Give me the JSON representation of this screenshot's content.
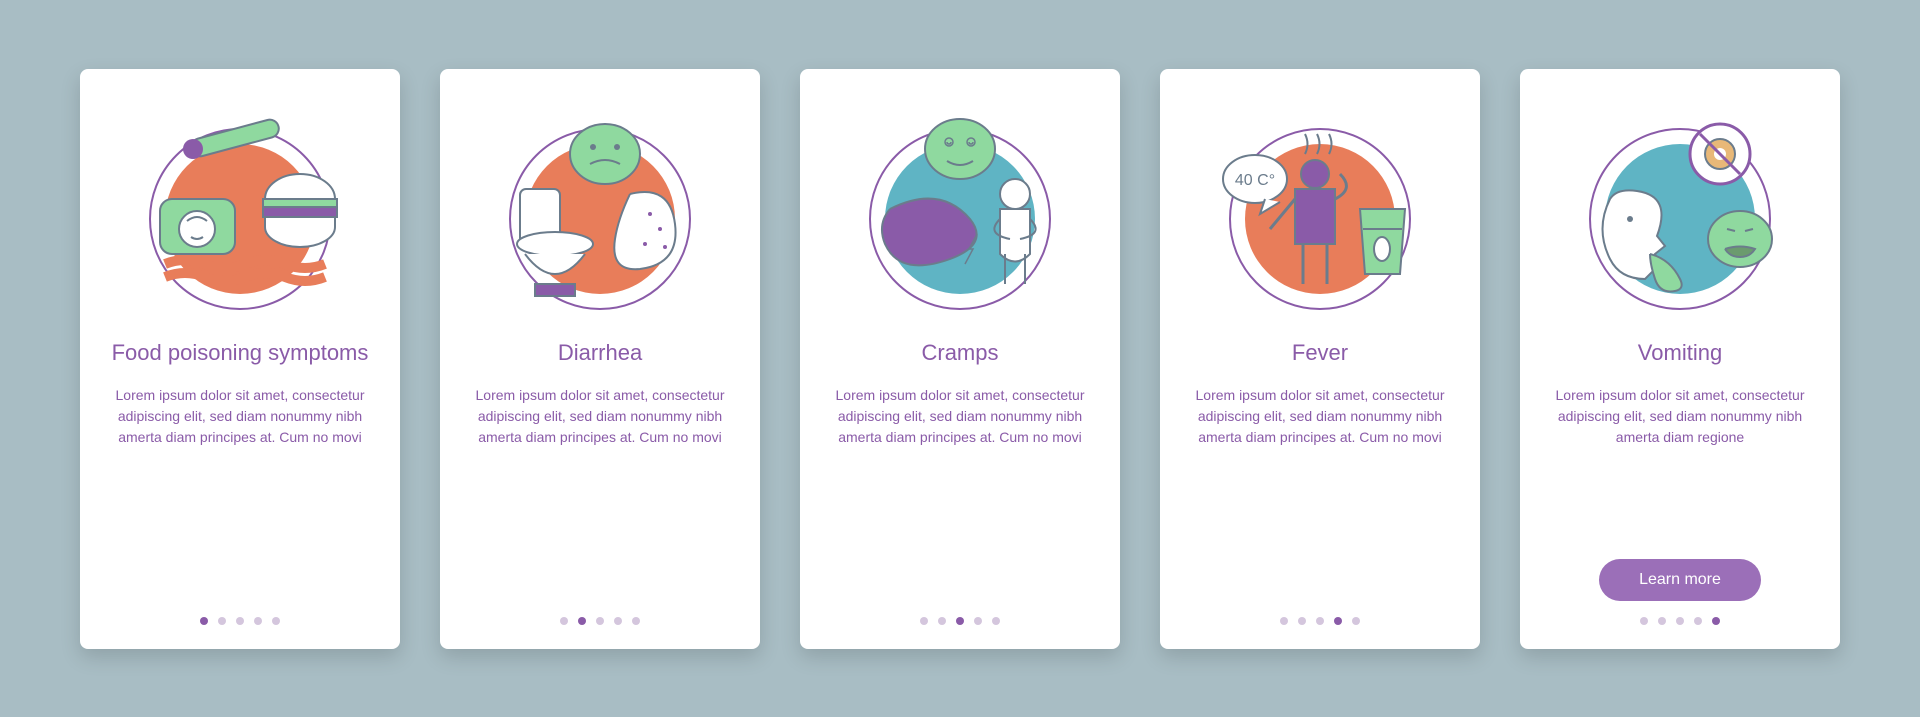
{
  "cards": [
    {
      "title": "Food poisoning symptoms",
      "body": "Lorem ipsum dolor sit amet, consectetur adipiscing elit, sed diam nonummy nibh amerta diam principes at. Cum no movi",
      "activeDot": 0,
      "hasButton": false
    },
    {
      "title": "Diarrhea",
      "body": "Lorem ipsum dolor sit amet, consectetur adipiscing elit, sed diam nonummy nibh amerta diam principes at. Cum no movi",
      "activeDot": 1,
      "hasButton": false
    },
    {
      "title": "Cramps",
      "body": "Lorem ipsum dolor sit amet, consectetur adipiscing elit, sed diam nonummy nibh amerta diam principes at. Cum no movi",
      "activeDot": 2,
      "hasButton": false
    },
    {
      "title": "Fever",
      "body": "Lorem ipsum dolor sit amet, consectetur adipiscing elit, sed diam nonummy nibh amerta diam principes at. Cum no movi",
      "activeDot": 3,
      "hasButton": false
    },
    {
      "title": "Vomiting",
      "body": "Lorem ipsum dolor sit amet, consectetur adipiscing elit, sed diam nonummy nibh amerta diam regione",
      "activeDot": 4,
      "hasButton": true
    }
  ],
  "button": {
    "label": "Learn more"
  },
  "dotCount": 5,
  "colors": {
    "accent": "#8a5ba8",
    "button": "#9b6fb8",
    "dotInactive": "#d4c6dd",
    "background": "#a8bdc4"
  }
}
